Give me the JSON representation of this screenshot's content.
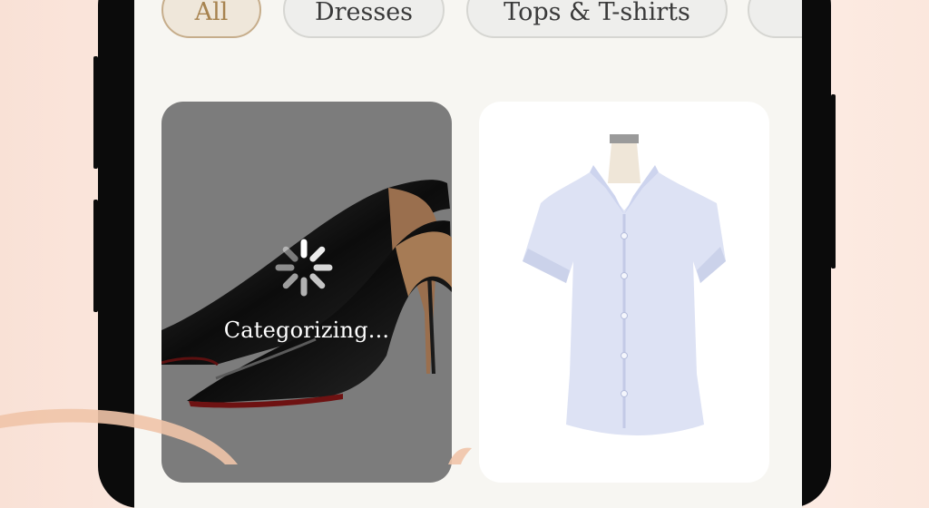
{
  "filters": {
    "chips": [
      {
        "label": "All",
        "active": true
      },
      {
        "label": "Dresses",
        "active": false
      },
      {
        "label": "Tops & T-shirts",
        "active": false
      }
    ]
  },
  "items": [
    {
      "name": "black-patent-pumps",
      "status_text": "Categorizing..."
    },
    {
      "name": "light-blue-short-sleeve-shirt"
    }
  ],
  "colors": {
    "accent": "#c6ad8b",
    "accent_text": "#a7834f",
    "background_peach": "#fbe7dd",
    "screen": "#f7f6f2"
  }
}
